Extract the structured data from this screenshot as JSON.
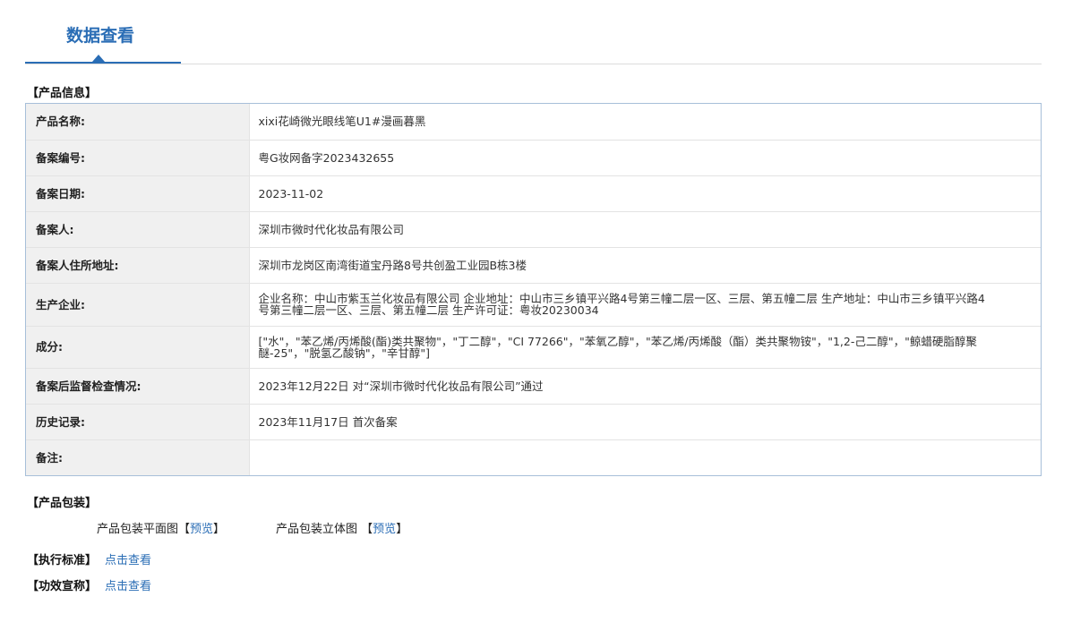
{
  "header": {
    "tab_title": "数据查看"
  },
  "sections": {
    "product_info": "【产品信息】",
    "packaging": "【产品包装】",
    "standard": "【执行标准】",
    "efficacy": "【功效宣称】"
  },
  "info_rows": {
    "product_name": {
      "label": "产品名称:",
      "value": "xixi花崎微光眼线笔U1#漫画暮黑"
    },
    "record_no": {
      "label": "备案编号:",
      "value": "粤G妆网备字2023432655"
    },
    "record_date": {
      "label": "备案日期:",
      "value": "2023-11-02"
    },
    "registrant": {
      "label": "备案人:",
      "value": "深圳市微时代化妆品有限公司"
    },
    "registrant_address": {
      "label": "备案人住所地址:",
      "value": "深圳市龙岗区南湾街道宝丹路8号共创盈工业园B栋3楼"
    },
    "manufacturer": {
      "label": "生产企业:",
      "value": "企业名称：中山市紫玉兰化妆品有限公司 企业地址：中山市三乡镇平兴路4号第三幢二层一区、三层、第五幢二层 生产地址：中山市三乡镇平兴路4号第三幢二层一区、三层、第五幢二层 生产许可证：粤妆20230034"
    },
    "ingredients": {
      "label": "成分:",
      "value": "[\"水\"，\"苯乙烯/丙烯酸(酯)类共聚物\"，\"丁二醇\"，\"CI 77266\"，\"苯氧乙醇\"，\"苯乙烯/丙烯酸（酯）类共聚物铵\"，\"1,2-己二醇\"，\"鲸蜡硬脂醇聚醚-25\"，\"脱氢乙酸钠\"，\"辛甘醇\"]"
    },
    "post_inspection": {
      "label": "备案后监督检查情况:",
      "value": "2023年12月22日 对“深圳市微时代化妆品有限公司”通过"
    },
    "history": {
      "label": "历史记录:",
      "value": "2023年11月17日 首次备案"
    },
    "remarks": {
      "label": "备注:",
      "value": ""
    }
  },
  "packaging": {
    "flat_label": "产品包装平面图",
    "three_d_label": "产品包装立体图",
    "bracket_open": "【",
    "bracket_close": "】",
    "preview_label": "预览"
  },
  "links": {
    "view_label": "点击查看"
  },
  "colors": {
    "accent": "#2a6db5",
    "table_border": "#a7bfd9",
    "label_bg": "#f0f0f0"
  }
}
